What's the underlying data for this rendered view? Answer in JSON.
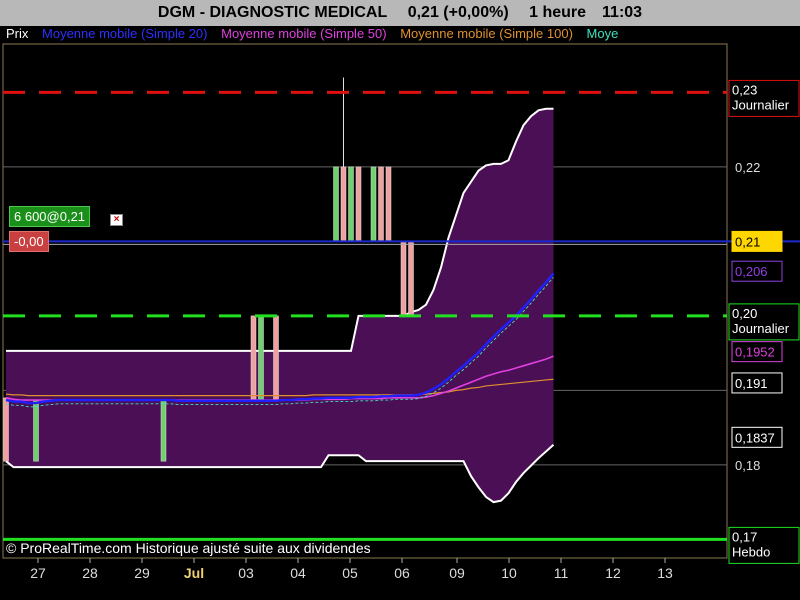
{
  "header": {
    "title": "DGM - DIAGNOSTIC MEDICAL",
    "quote": "0,21 (+0,00%)",
    "interval": "1 heure",
    "time": "11:03"
  },
  "legend": [
    {
      "label": "Prix",
      "color": "#ffffff"
    },
    {
      "label": "Moyenne mobile (Simple 20)",
      "color": "#3030ff"
    },
    {
      "label": "Moyenne mobile (Simple 50)",
      "color": "#e040e0"
    },
    {
      "label": "Moyenne mobile (Simple 100)",
      "color": "#e09030"
    },
    {
      "label": "Moye",
      "color": "#40e0c0"
    }
  ],
  "position": {
    "label": "6 600@0,21",
    "pnl": "-0,00",
    "close_icon": "close-icon"
  },
  "footer": {
    "copyright": "© ProRealTime.com Historique ajusté suite aux dividendes"
  },
  "chart_data": {
    "type": "candlestick",
    "x_ticks": [
      "27",
      "28",
      "29",
      "Jul",
      "03",
      "04",
      "05",
      "06",
      "09",
      "10",
      "11",
      "12",
      "13"
    ],
    "y_ticks": [
      "0,22",
      "0,18"
    ],
    "ylim": [
      0.1675,
      0.2365
    ],
    "levels": [
      {
        "value": 0.23,
        "label": "0,23",
        "sublabel": "Journalier",
        "color": "#e01010",
        "style": "dashed"
      },
      {
        "value": 0.2,
        "label": "0,20",
        "sublabel": "Journalier",
        "color": "#20e020",
        "style": "dashed"
      },
      {
        "value": 0.17,
        "label": "0,17",
        "sublabel": "Hebdo",
        "color": "#20e020",
        "style": "solid"
      }
    ],
    "value_tags": [
      {
        "value": 0.21,
        "label": "0,21",
        "bg": "#ffd700",
        "fg": "#000000",
        "border": "#ffd700"
      },
      {
        "value": 0.206,
        "label": "0,206",
        "bg": "#000000",
        "fg": "#9040e0",
        "border": "#9040e0"
      },
      {
        "value": 0.1952,
        "label": "0,1952",
        "bg": "#000000",
        "fg": "#e040e0",
        "border": "#e040e0"
      },
      {
        "value": 0.191,
        "label": "0,191",
        "bg": "#000000",
        "fg": "#ffffff",
        "border": "#ffffff"
      },
      {
        "value": 0.1837,
        "label": "0,1837",
        "bg": "#000000",
        "fg": "#ffffff",
        "border": "#ffffff"
      }
    ],
    "price_line": 0.21,
    "bands": {
      "upper": [
        0.1953,
        0.1953,
        0.1953,
        0.1953,
        0.1953,
        0.1953,
        0.1953,
        0.1953,
        0.1953,
        0.1953,
        0.1953,
        0.1953,
        0.1953,
        0.1953,
        0.1953,
        0.1953,
        0.1953,
        0.1953,
        0.1953,
        0.1953,
        0.1953,
        0.1953,
        0.1953,
        0.1953,
        0.1953,
        0.1953,
        0.1953,
        0.1953,
        0.1953,
        0.1953,
        0.1953,
        0.1953,
        0.1953,
        0.1953,
        0.1953,
        0.1953,
        0.1953,
        0.1953,
        0.1953,
        0.1953,
        0.1953,
        0.1953,
        0.1953,
        0.1953,
        0.1953,
        0.1953,
        0.1953,
        0.2,
        0.2,
        0.2,
        0.2,
        0.2,
        0.2,
        0.2,
        0.2005,
        0.2008,
        0.2015,
        0.2035,
        0.2065,
        0.2105,
        0.2135,
        0.2165,
        0.218,
        0.2195,
        0.2202,
        0.2204,
        0.2204,
        0.2209,
        0.2234,
        0.2256,
        0.2268,
        0.2276,
        0.2278,
        0.2278
      ],
      "lower": [
        0.1805,
        0.1797,
        0.1797,
        0.1797,
        0.1797,
        0.1797,
        0.1797,
        0.1797,
        0.1797,
        0.1797,
        0.1797,
        0.1797,
        0.1797,
        0.1797,
        0.1797,
        0.1797,
        0.1797,
        0.1797,
        0.1797,
        0.1797,
        0.1797,
        0.1797,
        0.1797,
        0.1797,
        0.1797,
        0.1797,
        0.1797,
        0.1797,
        0.1797,
        0.1797,
        0.1797,
        0.1797,
        0.1797,
        0.1797,
        0.1797,
        0.1797,
        0.1797,
        0.1797,
        0.1797,
        0.1797,
        0.1797,
        0.1797,
        0.1797,
        0.1813,
        0.1813,
        0.1813,
        0.1813,
        0.1813,
        0.1805,
        0.1805,
        0.1805,
        0.1805,
        0.1805,
        0.1805,
        0.1805,
        0.1805,
        0.1805,
        0.1805,
        0.1805,
        0.1805,
        0.1805,
        0.1805,
        0.1785,
        0.177,
        0.1757,
        0.175,
        0.1752,
        0.1762,
        0.1777,
        0.1789,
        0.1799,
        0.1809,
        0.1818,
        0.1827
      ]
    },
    "sma20": [
      0.1887,
      0.1885,
      0.1885,
      0.1883,
      0.1883,
      0.1885,
      0.1886,
      0.1887,
      0.1887,
      0.1887,
      0.1887,
      0.1887,
      0.1887,
      0.1887,
      0.1887,
      0.1887,
      0.1887,
      0.1887,
      0.1887,
      0.1887,
      0.1887,
      0.1887,
      0.1887,
      0.1886,
      0.1886,
      0.1886,
      0.1886,
      0.1886,
      0.1886,
      0.1886,
      0.1886,
      0.1886,
      0.1886,
      0.1886,
      0.1886,
      0.1886,
      0.1886,
      0.1887,
      0.1887,
      0.1888,
      0.1888,
      0.1889,
      0.1889,
      0.189,
      0.189,
      0.189,
      0.189,
      0.1891,
      0.1891,
      0.1891,
      0.1892,
      0.1892,
      0.1893,
      0.1893,
      0.1893,
      0.1894,
      0.1897,
      0.1902,
      0.1908,
      0.1916,
      0.1925,
      0.1933,
      0.1942,
      0.1951,
      0.1962,
      0.1972,
      0.1982,
      0.1991,
      0.2,
      0.2011,
      0.2022,
      0.2034,
      0.2045,
      0.2057
    ],
    "sma50": [
      0.189,
      0.1888,
      0.1887,
      0.1887,
      0.1887,
      0.1887,
      0.1887,
      0.1887,
      0.1887,
      0.1887,
      0.1887,
      0.1887,
      0.1887,
      0.1887,
      0.1887,
      0.1887,
      0.1887,
      0.1887,
      0.1887,
      0.1887,
      0.1887,
      0.1887,
      0.1887,
      0.1887,
      0.1887,
      0.1887,
      0.1887,
      0.1887,
      0.1887,
      0.1887,
      0.1887,
      0.1887,
      0.1887,
      0.1887,
      0.1887,
      0.1887,
      0.1887,
      0.1887,
      0.1887,
      0.1887,
      0.1887,
      0.1888,
      0.1888,
      0.1888,
      0.1888,
      0.1888,
      0.1889,
      0.1889,
      0.1889,
      0.1889,
      0.1889,
      0.189,
      0.189,
      0.189,
      0.189,
      0.189,
      0.1891,
      0.1893,
      0.1896,
      0.1899,
      0.1903,
      0.1907,
      0.1911,
      0.1915,
      0.1919,
      0.1922,
      0.1925,
      0.1927,
      0.193,
      0.1933,
      0.1936,
      0.1939,
      0.1942,
      0.1946
    ],
    "sma100": [
      0.1895,
      0.1894,
      0.1894,
      0.1893,
      0.1893,
      0.1893,
      0.1893,
      0.1893,
      0.1893,
      0.1893,
      0.1893,
      0.1893,
      0.1893,
      0.1893,
      0.1893,
      0.1893,
      0.1893,
      0.1893,
      0.1893,
      0.1893,
      0.1893,
      0.1893,
      0.1893,
      0.1893,
      0.1893,
      0.1893,
      0.1893,
      0.1893,
      0.1893,
      0.1893,
      0.1893,
      0.1893,
      0.1893,
      0.1893,
      0.1893,
      0.1893,
      0.1893,
      0.1893,
      0.1893,
      0.1893,
      0.1893,
      0.1894,
      0.1894,
      0.1894,
      0.1894,
      0.1894,
      0.1894,
      0.1894,
      0.1894,
      0.1894,
      0.1894,
      0.1894,
      0.1894,
      0.1894,
      0.1894,
      0.1894,
      0.1895,
      0.1896,
      0.1897,
      0.1898,
      0.19,
      0.1901,
      0.1903,
      0.1904,
      0.1906,
      0.1907,
      0.1908,
      0.1909,
      0.191,
      0.1911,
      0.1912,
      0.1913,
      0.1914,
      0.1915
    ],
    "candles": [
      {
        "i": 0,
        "o": 0.189,
        "h": 0.189,
        "l": 0.1805,
        "c": 0.1805,
        "dir": "down"
      },
      {
        "i": 4,
        "o": 0.1805,
        "h": 0.1887,
        "l": 0.1805,
        "c": 0.1887,
        "dir": "up"
      },
      {
        "i": 21,
        "o": 0.1805,
        "h": 0.1887,
        "l": 0.1805,
        "c": 0.1887,
        "dir": "up"
      },
      {
        "i": 33,
        "o": 0.2,
        "h": 0.2,
        "l": 0.1887,
        "c": 0.1887,
        "dir": "down"
      },
      {
        "i": 34,
        "o": 0.1887,
        "h": 0.2,
        "l": 0.1887,
        "c": 0.2,
        "dir": "up"
      },
      {
        "i": 36,
        "o": 0.2,
        "h": 0.2,
        "l": 0.1887,
        "c": 0.1887,
        "dir": "down"
      },
      {
        "i": 44,
        "o": 0.21,
        "h": 0.22,
        "l": 0.21,
        "c": 0.22,
        "dir": "up"
      },
      {
        "i": 45,
        "o": 0.22,
        "h": 0.232,
        "l": 0.21,
        "c": 0.21,
        "dir": "down"
      },
      {
        "i": 46,
        "o": 0.21,
        "h": 0.22,
        "l": 0.21,
        "c": 0.22,
        "dir": "up"
      },
      {
        "i": 47,
        "o": 0.22,
        "h": 0.22,
        "l": 0.21,
        "c": 0.21,
        "dir": "down"
      },
      {
        "i": 49,
        "o": 0.21,
        "h": 0.22,
        "l": 0.21,
        "c": 0.22,
        "dir": "up"
      },
      {
        "i": 50,
        "o": 0.22,
        "h": 0.22,
        "l": 0.21,
        "c": 0.21,
        "dir": "down"
      },
      {
        "i": 51,
        "o": 0.22,
        "h": 0.22,
        "l": 0.21,
        "c": 0.21,
        "dir": "down"
      },
      {
        "i": 53,
        "o": 0.21,
        "h": 0.21,
        "l": 0.2,
        "c": 0.2,
        "dir": "down"
      },
      {
        "i": 54,
        "o": 0.21,
        "h": 0.21,
        "l": 0.2,
        "c": 0.2,
        "dir": "down"
      }
    ]
  }
}
